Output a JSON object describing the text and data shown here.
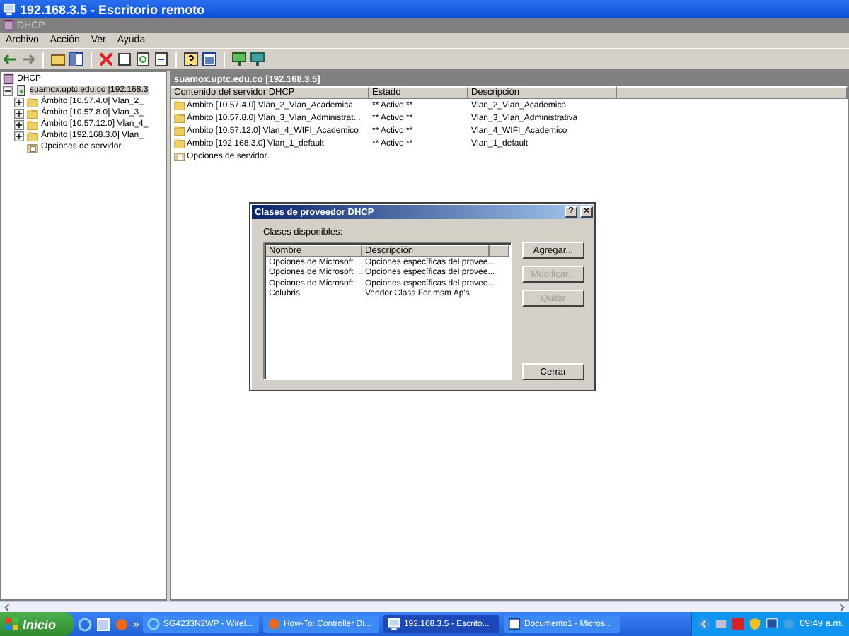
{
  "window": {
    "title": "192.168.3.5 - Escritorio remoto"
  },
  "app": {
    "title": "DHCP"
  },
  "menu": [
    "Archivo",
    "Acción",
    "Ver",
    "Ayuda"
  ],
  "tree": {
    "root": "DHCP",
    "children": [
      {
        "label": "suamox.uptc.edu.co [192.168.3",
        "expanded": true,
        "selected": true,
        "children": [
          {
            "label": "Ámbito [10.57.4.0] Vlan_2_",
            "kind": "scope"
          },
          {
            "label": "Ámbito [10.57.8.0] Vlan_3_",
            "kind": "scope"
          },
          {
            "label": "Ámbito [10.57.12.0] Vlan_4_",
            "kind": "scope"
          },
          {
            "label": "Ámbito [192.168.3.0] Vlan_",
            "kind": "scope"
          },
          {
            "label": "Opciones de servidor",
            "kind": "options"
          }
        ]
      }
    ]
  },
  "pane": {
    "title": "suamox.uptc.edu.co [192.168.3.5]",
    "columns": [
      "Contenido del servidor DHCP",
      "Estado",
      "Descripción"
    ],
    "rows": [
      {
        "kind": "scope",
        "name": "Ámbito [10.57.4.0] Vlan_2_Vlan_Academica",
        "status": "** Activo **",
        "description": "Vlan_2_Vlan_Academica"
      },
      {
        "kind": "scope",
        "name": "Ámbito [10.57.8.0] Vlan_3_Vlan_Administrat...",
        "status": "** Activo **",
        "description": "Vlan_3_Vlan_Administrativa"
      },
      {
        "kind": "scope",
        "name": "Ámbito [10.57.12.0] Vlan_4_WIFI_Academico",
        "status": "** Activo **",
        "description": "Vlan_4_WIFI_Academico"
      },
      {
        "kind": "scope",
        "name": "Ámbito [192.168.3.0] Vlan_1_default",
        "status": "** Activo **",
        "description": "Vlan_1_default"
      },
      {
        "kind": "options",
        "name": "Opciones de servidor"
      }
    ]
  },
  "dialog": {
    "title": "Clases de proveedor DHCP",
    "help": "?",
    "close": "×",
    "label": "Clases disponibles:",
    "columns": [
      "Nombre",
      "Descripción"
    ],
    "rows": [
      {
        "name": "Opciones de Microsoft ...",
        "description": "Opciones específicas del provee..."
      },
      {
        "name": "Opciones de Microsoft ...",
        "description": "Opciones específicas del provee..."
      },
      {
        "name": "Opciones de Microsoft",
        "description": "Opciones específicas del provee..."
      },
      {
        "name": "Colubris",
        "description": "Vendor Class For msm Ap's"
      }
    ],
    "buttons": [
      {
        "label": "Agregar...",
        "disabled": false
      },
      {
        "label": "Modificar...",
        "disabled": true
      },
      {
        "label": "Quitar",
        "disabled": true
      }
    ],
    "close_button": "Cerrar"
  },
  "taskbar": {
    "start": "Inicio",
    "more": "»",
    "tasks": [
      {
        "label": "SG4233N2WP - Wirel...",
        "kind": "browser",
        "selected": false
      },
      {
        "label": "How-To: Controller Di...",
        "kind": "firefox",
        "selected": false
      },
      {
        "label": "192.168.3.5 - Escrito...",
        "kind": "remote",
        "selected": true
      },
      {
        "label": "Documento1 - Micros...",
        "kind": "word",
        "selected": false
      }
    ],
    "time": "09:49 a.m."
  }
}
